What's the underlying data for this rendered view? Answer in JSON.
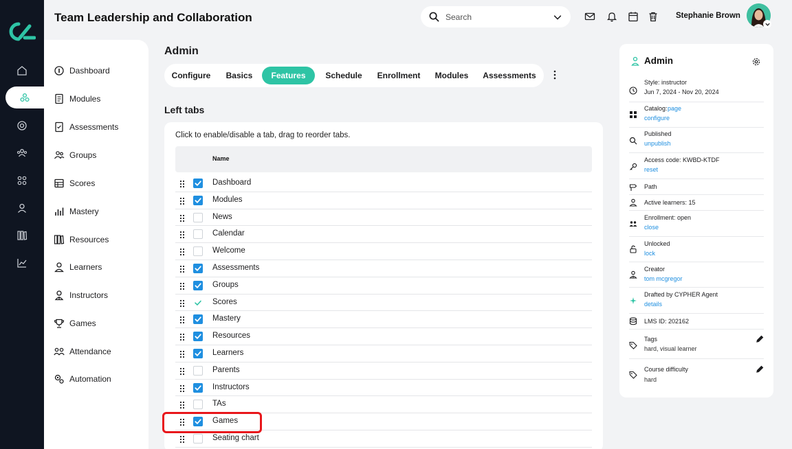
{
  "app": {
    "title": "Team Leadership and Collaboration"
  },
  "header": {
    "search_placeholder": "Search",
    "user_name": "Stephanie Brown"
  },
  "sidebar": {
    "items": [
      {
        "label": "Dashboard",
        "icon": "dashboard-icon"
      },
      {
        "label": "Modules",
        "icon": "modules-icon"
      },
      {
        "label": "Assessments",
        "icon": "assessments-icon"
      },
      {
        "label": "Groups",
        "icon": "groups-icon"
      },
      {
        "label": "Scores",
        "icon": "scores-icon"
      },
      {
        "label": "Mastery",
        "icon": "mastery-icon"
      },
      {
        "label": "Resources",
        "icon": "resources-icon"
      },
      {
        "label": "Learners",
        "icon": "learners-icon"
      },
      {
        "label": "Instructors",
        "icon": "instructors-icon"
      },
      {
        "label": "Games",
        "icon": "games-icon"
      },
      {
        "label": "Attendance",
        "icon": "attendance-icon"
      },
      {
        "label": "Automation",
        "icon": "automation-icon"
      }
    ]
  },
  "main": {
    "heading": "Admin",
    "tabs": [
      "Configure",
      "Basics",
      "Features",
      "Schedule",
      "Enrollment",
      "Modules",
      "Assessments"
    ],
    "active_tab": "Features",
    "section_title": "Left tabs",
    "hint": "Click to enable/disable a tab, drag to reorder tabs.",
    "column_header": "Name",
    "rows": [
      {
        "label": "Dashboard",
        "state": "checked"
      },
      {
        "label": "Modules",
        "state": "checked"
      },
      {
        "label": "News",
        "state": "unchecked"
      },
      {
        "label": "Calendar",
        "state": "unchecked"
      },
      {
        "label": "Welcome",
        "state": "unchecked"
      },
      {
        "label": "Assessments",
        "state": "checked"
      },
      {
        "label": "Groups",
        "state": "checked"
      },
      {
        "label": "Scores",
        "state": "locked"
      },
      {
        "label": "Mastery",
        "state": "checked"
      },
      {
        "label": "Resources",
        "state": "checked"
      },
      {
        "label": "Learners",
        "state": "checked"
      },
      {
        "label": "Parents",
        "state": "unchecked"
      },
      {
        "label": "Instructors",
        "state": "checked"
      },
      {
        "label": "TAs",
        "state": "unchecked"
      },
      {
        "label": "Games",
        "state": "checked"
      },
      {
        "label": "Seating chart",
        "state": "unchecked"
      }
    ]
  },
  "panel": {
    "title": "Admin",
    "style": "Style: instructor",
    "dates": "Jun 7, 2024 - Nov 20, 2024",
    "catalog_label": "Catalog:",
    "catalog_link": "page",
    "catalog_action": "configure",
    "published": "Published",
    "unpublish": "unpublish",
    "access_code": "Access code: KWBD-KTDF",
    "reset": "reset",
    "path": "Path",
    "active_learners": "Active learners: 15",
    "enrollment": "Enrollment: open",
    "close": "close",
    "unlocked": "Unlocked",
    "lock": "lock",
    "creator_label": "Creator",
    "creator": "tom mcgregor",
    "drafted": "Drafted by CYPHER Agent",
    "details": "details",
    "lms_id": "LMS ID: 202162",
    "tags_label": "Tags",
    "tags": "hard, visual learner",
    "difficulty_label": "Course difficulty",
    "difficulty": "hard"
  },
  "colors": {
    "accent": "#2ec4a5",
    "checkbox": "#1f8fe0",
    "rail": "#0f1521",
    "highlight": "#e8161b"
  }
}
